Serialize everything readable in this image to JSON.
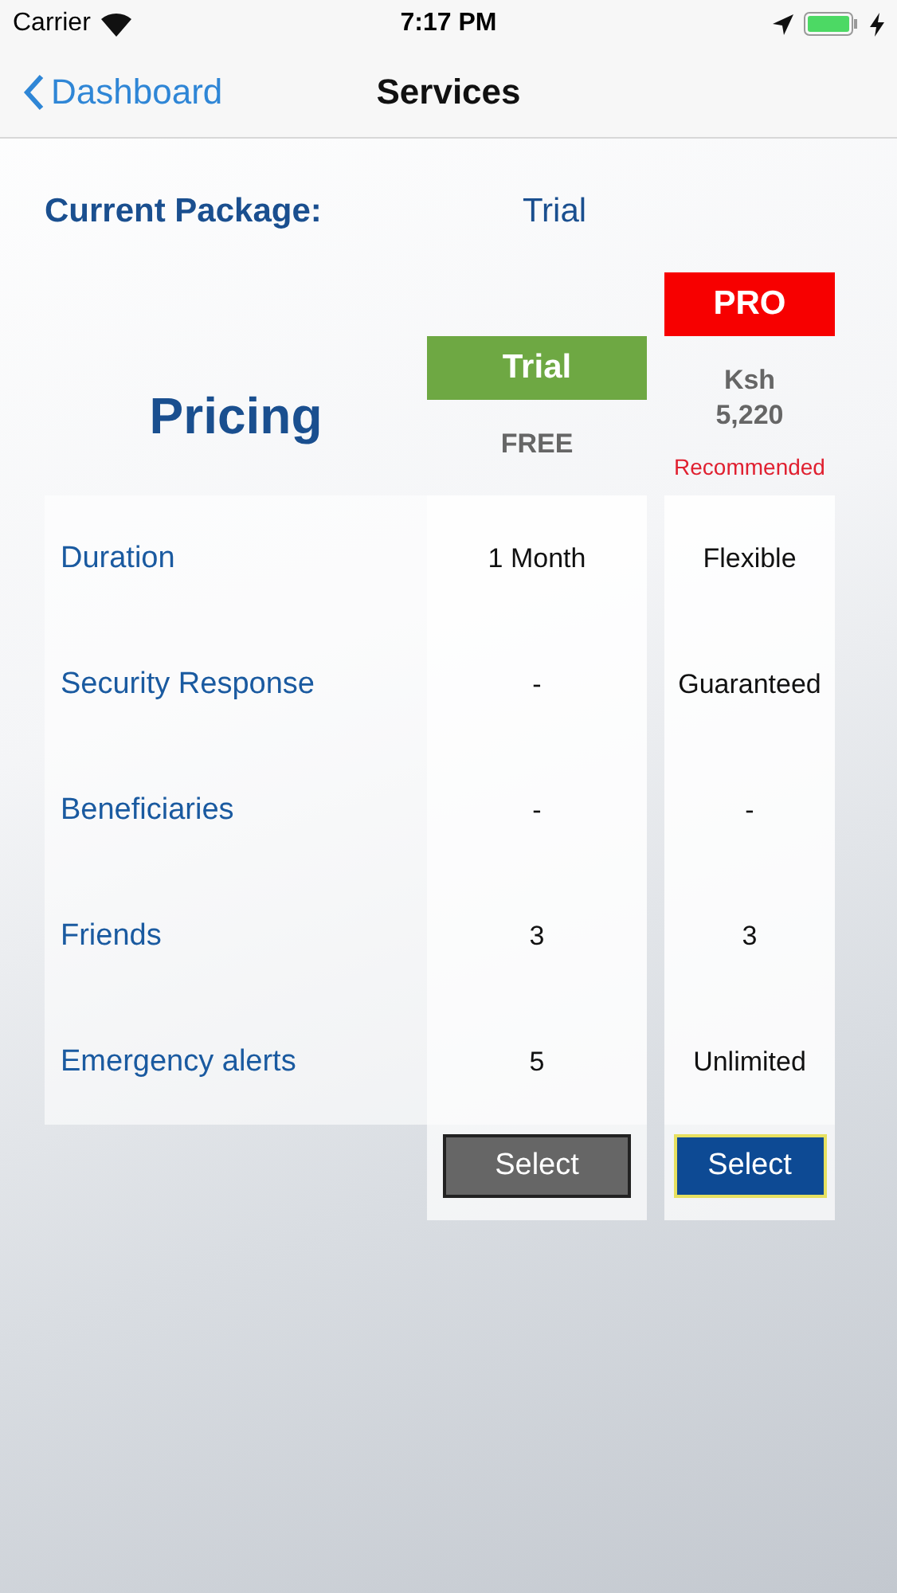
{
  "status_bar": {
    "carrier": "Carrier",
    "time": "7:17 PM"
  },
  "nav": {
    "back": "Dashboard",
    "title": "Services"
  },
  "current_package": {
    "label": "Current Package:",
    "value": "Trial"
  },
  "pricing_title": "Pricing",
  "plans": [
    {
      "kind": "basic",
      "name": "Trial",
      "color": "#6ea843",
      "price": [
        "FREE"
      ],
      "button": "Select"
    },
    {
      "kind": "featured",
      "name": "PRO",
      "color": "#f70000",
      "price": [
        "Ksh",
        "5,220"
      ],
      "note": "Recommended",
      "button": "Select"
    }
  ],
  "features": [
    {
      "label": "Duration",
      "values": [
        "1 Month",
        "Flexible"
      ]
    },
    {
      "label": "Security Response",
      "values": [
        "-",
        "Guaranteed"
      ]
    },
    {
      "label": "Beneficiaries",
      "values": [
        "-",
        "-"
      ]
    },
    {
      "label": "Friends",
      "values": [
        "3",
        "3"
      ]
    },
    {
      "label": "Emergency alerts",
      "values": [
        "5",
        "Unlimited"
      ]
    }
  ]
}
